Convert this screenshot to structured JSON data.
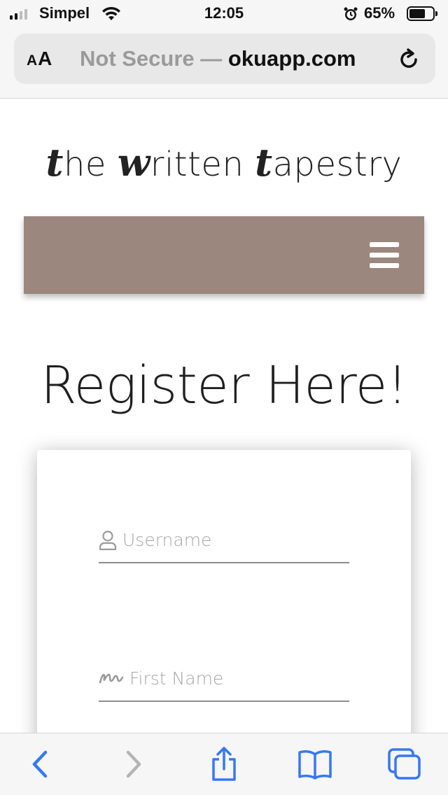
{
  "status_bar": {
    "carrier": "Simpel",
    "time": "12:05",
    "battery_percent": "65%",
    "signal_bars": 4,
    "signal_active": 2,
    "battery_level": 0.65
  },
  "browser": {
    "text_size_label": "AA",
    "security_label": "Not Secure —",
    "domain": "okuapp.com"
  },
  "site": {
    "title_parts": [
      "t",
      "he ",
      "w",
      "ritten ",
      "t",
      "apestry"
    ]
  },
  "page": {
    "heading": "Register Here!"
  },
  "form": {
    "username_placeholder": "Username",
    "first_name_placeholder": "First Name"
  },
  "colors": {
    "navbar": "#9b877e",
    "ios_blue": "#3478f6",
    "disabled_gray": "#b4b4b4"
  },
  "icons": {
    "toolbar": [
      "back-icon",
      "forward-icon",
      "share-icon",
      "bookmarks-icon",
      "tabs-icon"
    ],
    "fields": [
      "user-icon",
      "signature-icon"
    ]
  }
}
